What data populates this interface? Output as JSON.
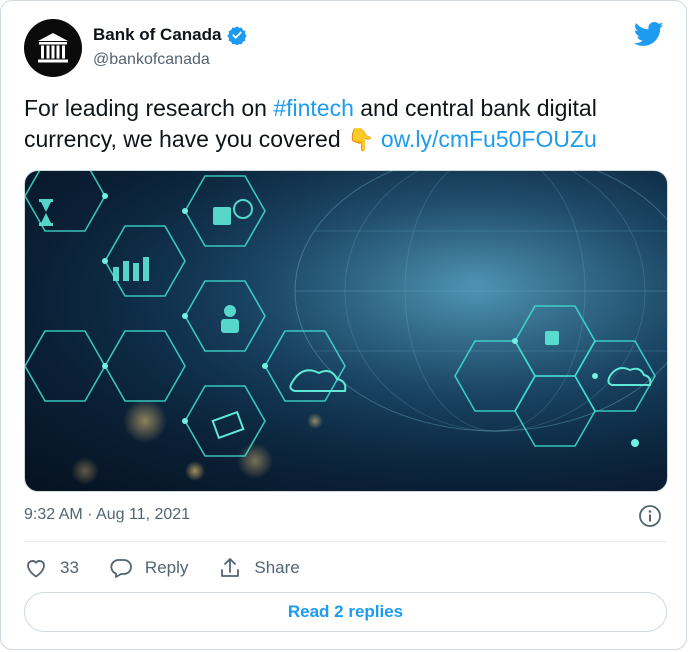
{
  "tweet": {
    "author_name": "Bank of Canada",
    "author_handle": "@bankofcanada",
    "text_before_hashtag": "For leading research on ",
    "hashtag": "#fintech",
    "text_after_hashtag": " and central bank digital currency, we have you covered ",
    "emoji": "👇",
    "link": "ow.ly/cmFu50FOUZu",
    "timestamp": "9:32 AM · Aug 11, 2021",
    "like_count": "33",
    "reply_label": "Reply",
    "share_label": "Share",
    "read_replies_label": "Read 2 replies"
  },
  "colors": {
    "accent": "#1d9bf0",
    "secondary_text": "#536471",
    "border": "#cfd9de"
  },
  "icons": {
    "avatar": "bank-building-icon",
    "verified": "verified-badge-icon",
    "brand": "twitter-bird-icon",
    "info": "info-icon",
    "like": "heart-icon",
    "reply": "speech-bubble-icon",
    "share": "share-upload-icon"
  }
}
